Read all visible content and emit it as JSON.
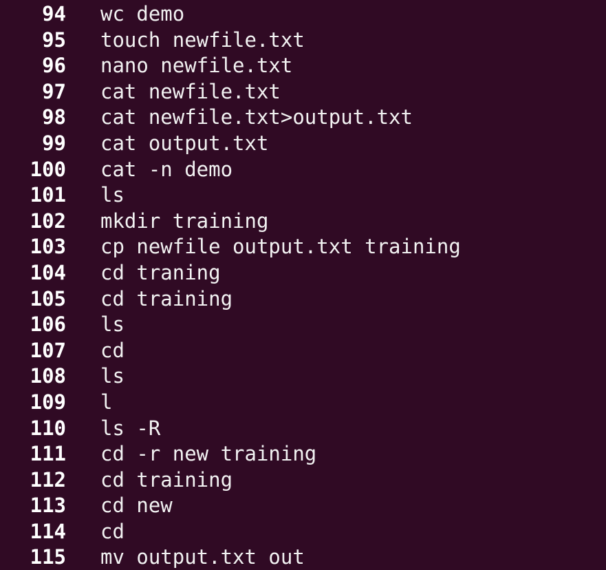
{
  "colors": {
    "background": "#300a24",
    "text": "#ffffff"
  },
  "history": [
    {
      "num": "94",
      "cmd": "wc demo"
    },
    {
      "num": "95",
      "cmd": "touch newfile.txt"
    },
    {
      "num": "96",
      "cmd": "nano newfile.txt"
    },
    {
      "num": "97",
      "cmd": "cat newfile.txt"
    },
    {
      "num": "98",
      "cmd": "cat newfile.txt>output.txt"
    },
    {
      "num": "99",
      "cmd": "cat output.txt"
    },
    {
      "num": "100",
      "cmd": "cat -n demo"
    },
    {
      "num": "101",
      "cmd": "ls"
    },
    {
      "num": "102",
      "cmd": "mkdir training"
    },
    {
      "num": "103",
      "cmd": "cp newfile output.txt training"
    },
    {
      "num": "104",
      "cmd": "cd traning"
    },
    {
      "num": "105",
      "cmd": "cd training"
    },
    {
      "num": "106",
      "cmd": "ls"
    },
    {
      "num": "107",
      "cmd": "cd"
    },
    {
      "num": "108",
      "cmd": "ls"
    },
    {
      "num": "109",
      "cmd": "l"
    },
    {
      "num": "110",
      "cmd": "ls -R"
    },
    {
      "num": "111",
      "cmd": "cd -r new training"
    },
    {
      "num": "112",
      "cmd": "cd training"
    },
    {
      "num": "113",
      "cmd": "cd new"
    },
    {
      "num": "114",
      "cmd": "cd"
    },
    {
      "num": "115",
      "cmd": "mv output.txt out"
    }
  ]
}
